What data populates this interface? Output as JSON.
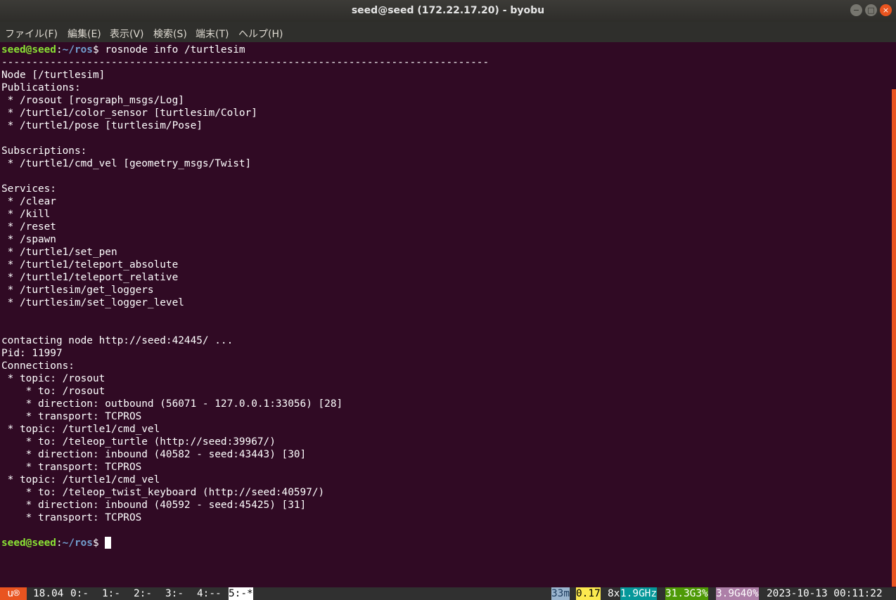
{
  "window": {
    "title": "seed@seed (172.22.17.20) - byobu",
    "minimize_icon": "−",
    "maximize_icon": "□",
    "close_icon": "×"
  },
  "menu": [
    "ファイル(F)",
    "編集(E)",
    "表示(V)",
    "検索(S)",
    "端末(T)",
    "ヘルプ(H)"
  ],
  "terminal": {
    "prompt_user": "seed@seed",
    "prompt_sep": ":",
    "prompt_path": "~/ros",
    "prompt_symbol": "$ ",
    "command": "rosnode info /turtlesim",
    "output": [
      "--------------------------------------------------------------------------------",
      "Node [/turtlesim]",
      "Publications:",
      " * /rosout [rosgraph_msgs/Log]",
      " * /turtle1/color_sensor [turtlesim/Color]",
      " * /turtle1/pose [turtlesim/Pose]",
      "",
      "Subscriptions:",
      " * /turtle1/cmd_vel [geometry_msgs/Twist]",
      "",
      "Services:",
      " * /clear",
      " * /kill",
      " * /reset",
      " * /spawn",
      " * /turtle1/set_pen",
      " * /turtle1/teleport_absolute",
      " * /turtle1/teleport_relative",
      " * /turtlesim/get_loggers",
      " * /turtlesim/set_logger_level",
      "",
      "",
      "contacting node http://seed:42445/ ...",
      "Pid: 11997",
      "Connections:",
      " * topic: /rosout",
      "    * to: /rosout",
      "    * direction: outbound (56071 - 127.0.0.1:33056) [28]",
      "    * transport: TCPROS",
      " * topic: /turtle1/cmd_vel",
      "    * to: /teleop_turtle (http://seed:39967/)",
      "    * direction: inbound (40582 - seed:43443) [30]",
      "    * transport: TCPROS",
      " * topic: /turtle1/cmd_vel",
      "    * to: /teleop_twist_keyboard (http://seed:40597/)",
      "    * direction: inbound (40592 - seed:45425) [31]",
      "    * transport: TCPROS",
      ""
    ]
  },
  "statusbar": {
    "logo": "u®",
    "version": "18.04",
    "windows": [
      "0:-",
      "1:-",
      "2:-",
      "3:-",
      "4:--",
      "5:-*"
    ],
    "uptime": "33m",
    "load": "0.17",
    "cpu_count": "8x",
    "cpu_freq": "1.9GHz",
    "mem": "31.3G3%",
    "disk": "3.9G40%",
    "datetime": "2023-10-13 00:11:22",
    "colors": {
      "logo_bg": "#e95420",
      "uptime_bg": "#9ab5cf",
      "load_bg": "#fce94f",
      "cpu_freq_bg": "#06989a",
      "mem_bg": "#4e9a06",
      "disk_bg": "#ad7fa8"
    }
  }
}
